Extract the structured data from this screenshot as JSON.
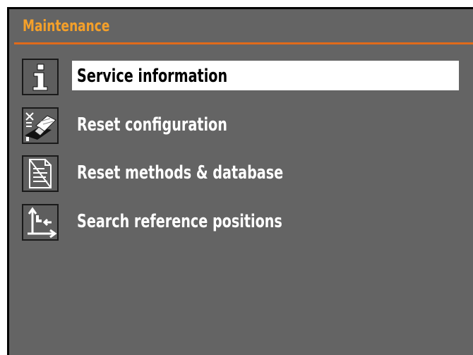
{
  "header": {
    "title": "Maintenance"
  },
  "colors": {
    "background": "#646464",
    "title": "#f4a02a",
    "rule": "#e06a1a",
    "selection": "#ffffff"
  },
  "menu": {
    "selected_index": 0,
    "items": [
      {
        "label": "Service information",
        "icon": "info-icon"
      },
      {
        "label": "Reset configuration",
        "icon": "eraser-icon"
      },
      {
        "label": "Reset methods & database",
        "icon": "crossed-document-icon"
      },
      {
        "label": "Search reference positions",
        "icon": "reference-axes-icon"
      }
    ]
  }
}
